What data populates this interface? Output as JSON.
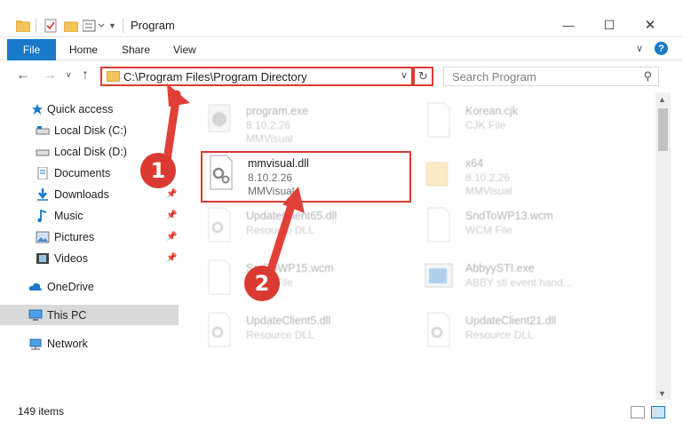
{
  "window": {
    "title": "Program",
    "minimize": "—",
    "maximize": "☐",
    "close": "✕"
  },
  "ribbon": {
    "tabs": [
      "File",
      "Home",
      "Share",
      "View"
    ],
    "help": "?"
  },
  "address": {
    "path": "C:\\Program Files\\Program Directory",
    "search_placeholder": "Search Program"
  },
  "sidebar": {
    "items": [
      {
        "label": "Quick access",
        "icon": "star-icon"
      },
      {
        "label": "Local Disk (C:)",
        "icon": "drive-icon"
      },
      {
        "label": "Local Disk (D:)",
        "icon": "drive-icon"
      },
      {
        "label": "Documents",
        "icon": "documents-icon"
      },
      {
        "label": "Downloads",
        "icon": "download-icon"
      },
      {
        "label": "Music",
        "icon": "music-icon"
      },
      {
        "label": "Pictures",
        "icon": "pictures-icon"
      },
      {
        "label": "Videos",
        "icon": "videos-icon"
      },
      {
        "label": "OneDrive",
        "icon": "cloud-icon"
      },
      {
        "label": "This PC",
        "icon": "computer-icon"
      },
      {
        "label": "Network",
        "icon": "network-icon"
      }
    ]
  },
  "files": [
    {
      "name": "program.exe",
      "line1": "8.10.2.26",
      "line2": "MMVisual"
    },
    {
      "name": "Korean.cjk",
      "line1": "CJK File",
      "line2": ""
    },
    {
      "name": "mmvisual.dll",
      "line1": "8.10.2.26",
      "line2": "MMVisual"
    },
    {
      "name": "x64",
      "line1": "8.10.2.26",
      "line2": "MMVisual"
    },
    {
      "name": "UpdateClient65.dll",
      "line1": "Resource DLL",
      "line2": ""
    },
    {
      "name": "SndToWP13.wcm",
      "line1": "WCM File",
      "line2": ""
    },
    {
      "name": "SndToWP15.wcm",
      "line1": "WCM File",
      "line2": ""
    },
    {
      "name": "AbbyySTI.exe",
      "line1": "ABBY sti event hand...",
      "line2": ""
    },
    {
      "name": "UpdateClient5.dll",
      "line1": "Resource DLL",
      "line2": ""
    },
    {
      "name": "UpdateClient21.dll",
      "line1": "Resource DLL",
      "line2": ""
    }
  ],
  "status": {
    "count": "149 items"
  },
  "annotations": [
    "1",
    "2"
  ],
  "colors": {
    "accent": "#1979ca",
    "highlight": "#d93a32"
  }
}
